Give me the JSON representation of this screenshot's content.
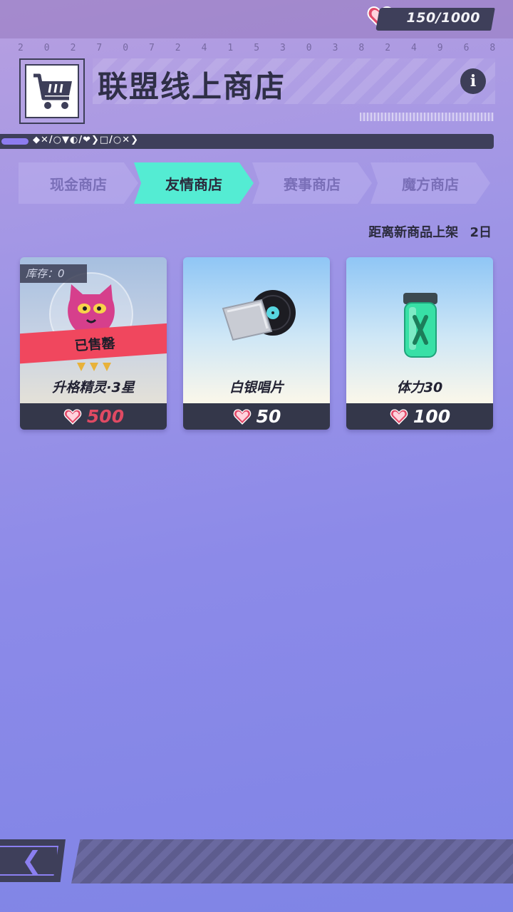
{
  "currency": {
    "value": "150/1000",
    "icon": "heart-icon",
    "color": "#e24b6a"
  },
  "ticker": [
    "2",
    "0",
    "2",
    "7",
    "0",
    "7",
    "2",
    "4",
    "1",
    "5",
    "3",
    "0",
    "3",
    "8",
    "2",
    "4",
    "9",
    "6",
    "8"
  ],
  "header": {
    "title": "联盟线上商店",
    "info_icon": "info-icon",
    "info_label": "i",
    "cart_icon": "shopping-cart-icon"
  },
  "symbols": "◆✕/○▼◐/❤❯□/○✕❯",
  "tabs": [
    {
      "label": "现金商店",
      "active": false
    },
    {
      "label": "友情商店",
      "active": true
    },
    {
      "label": "赛事商店",
      "active": false
    },
    {
      "label": "魔方商店",
      "active": false
    }
  ],
  "refresh": {
    "label": "距离新商品上架",
    "value": "2日"
  },
  "items": [
    {
      "name": "升格精灵·3星",
      "price": "500",
      "stock": "库存：0",
      "sold_label": "已售罄",
      "icon": "cat-spirit-icon",
      "sold_out": true
    },
    {
      "name": "白银唱片",
      "price": "50",
      "icon": "vinyl-record-icon",
      "sold_out": false
    },
    {
      "name": "体力30",
      "price": "100",
      "icon": "stamina-jar-icon",
      "sold_out": false
    }
  ],
  "back": {
    "label": "❮",
    "icon": "back-arrow-icon"
  },
  "colors": {
    "accent": "#54ecd3",
    "dark": "#34374a",
    "sold": "#f0475e"
  }
}
